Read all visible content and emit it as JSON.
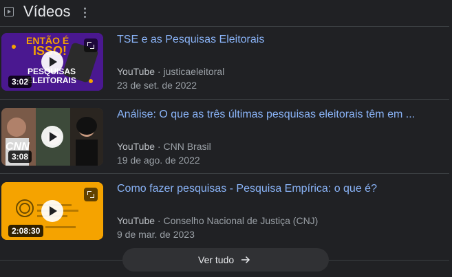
{
  "header": {
    "title": "Vídeos"
  },
  "videos": [
    {
      "title": "TSE e as Pesquisas Eleitorais",
      "platform": "YouTube",
      "channel": "justicaeleitoral",
      "date": "23 de set. de 2022",
      "duration": "3:02",
      "thumb_text_top": "ENTÃO É",
      "thumb_text_mid": "ISSO!",
      "thumb_text_bottom": "PESQUISAS ELEITORAIS",
      "thumb_color": "#5b1fa8"
    },
    {
      "title": "Análise: O que as três últimas pesquisas eleitorais têm em ...",
      "platform": "YouTube",
      "channel": "CNN Brasil",
      "date": "19 de ago. de 2022",
      "duration": "3:08",
      "thumb_logo": "CNN",
      "thumb_color": "#5a4a40"
    },
    {
      "title": "Como fazer pesquisas - Pesquisa Empírica: o que é?",
      "platform": "YouTube",
      "channel": "Conselho Nacional de Justiça (CNJ)",
      "date": "9 de mar. de 2023",
      "duration": "2:08:30",
      "thumb_color": "#f5a300"
    }
  ],
  "see_all": {
    "label": "Ver tudo"
  }
}
